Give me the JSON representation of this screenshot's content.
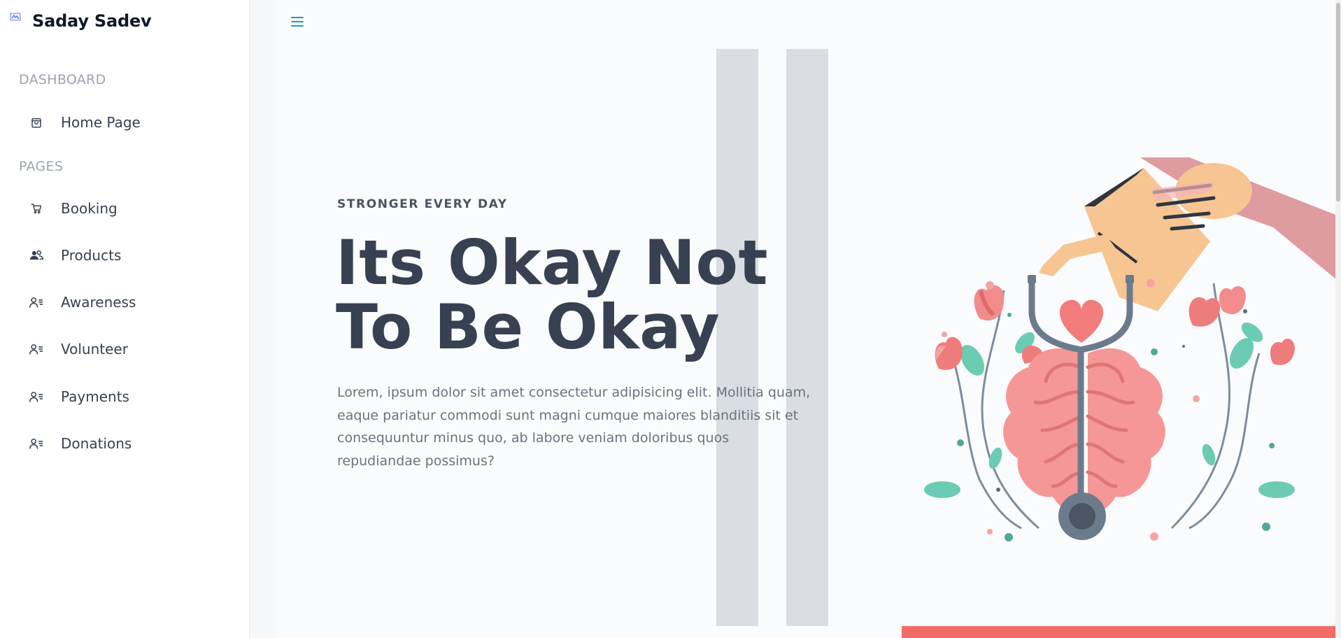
{
  "sidebar": {
    "brand": "Saday Sadev",
    "sections": [
      {
        "label": "DASHBOARD"
      },
      {
        "label": "PAGES"
      }
    ],
    "items": [
      {
        "label": "Home Page",
        "icon": "shopping-bag-icon"
      },
      {
        "label": "Booking",
        "icon": "cart-icon"
      },
      {
        "label": "Products",
        "icon": "users-icon"
      },
      {
        "label": "Awareness",
        "icon": "user-list-icon"
      },
      {
        "label": "Volunteer",
        "icon": "user-list-icon"
      },
      {
        "label": "Payments",
        "icon": "user-list-icon"
      },
      {
        "label": "Donations",
        "icon": "user-list-icon"
      }
    ]
  },
  "hero": {
    "eyebrow": "STRONGER EVERY DAY",
    "headline": "Its Okay Not To Be Okay",
    "body": "Lorem, ipsum dolor sit amet consectetur adipisicing elit. Mollitia quam, eaque pariatur commodi sunt magni cumque maiores blanditiis sit et consequuntur minus quo, ab labore veniam doloribus quos repudiandae possimus?"
  },
  "colors": {
    "accent": "#17a2b8",
    "headline": "#374151",
    "coral": "#f26b67",
    "stripe": "#dadde1"
  }
}
